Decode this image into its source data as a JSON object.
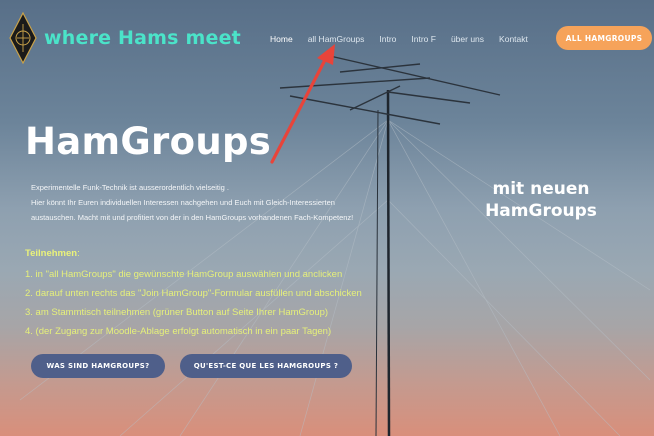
{
  "header": {
    "brand": "where Hams meet",
    "nav": [
      "Home",
      "all HamGroups",
      "Intro",
      "Intro F",
      "über uns",
      "Kontakt"
    ],
    "cta": "ALL HAMGROUPS"
  },
  "hero": {
    "title": "HamGroups",
    "intro_lines": [
      "Experimentelle Funk-Technik ist ausserordentlich vielseitig .",
      "Hier könnt Ihr Euren individuellen Interessen nachgehen und Euch mit Gleich-Interessierten",
      "austauschen. Macht mit und profitiert von der in den HamGroups vorhandenen Fach-Kompetenz!"
    ],
    "side_line1": "mit neuen",
    "side_line2": "HamGroups"
  },
  "join": {
    "heading": "Teilnehmen",
    "colon": ":",
    "steps": [
      "1. in \"all HamGroups\" die gewünschte HamGroup auswählen und anclicken",
      "2. darauf unten rechts das \"Join HamGroup\"-Formular ausfüllen und abschicken",
      "3. am Stammtisch teilnehmen (grüner Button auf Seite Ihrer HamGroup)",
      "4. (der Zugang zur Moodle-Ablage erfolgt automatisch in ein paar Tagen)"
    ]
  },
  "buttons": {
    "what": "WAS SIND HAMGROUPS?",
    "quest": "QU'EST-CE QUE LES HAMGROUPS ?"
  },
  "colors": {
    "brand": "#4be3c9",
    "cta": "#f6a35a",
    "steps": "#e6f07a",
    "button": "#4f5f8a",
    "arrow": "#e8443a"
  },
  "icons": {
    "logo": "diamond-antenna-logo-icon",
    "arrow": "annotation-arrow-icon"
  }
}
